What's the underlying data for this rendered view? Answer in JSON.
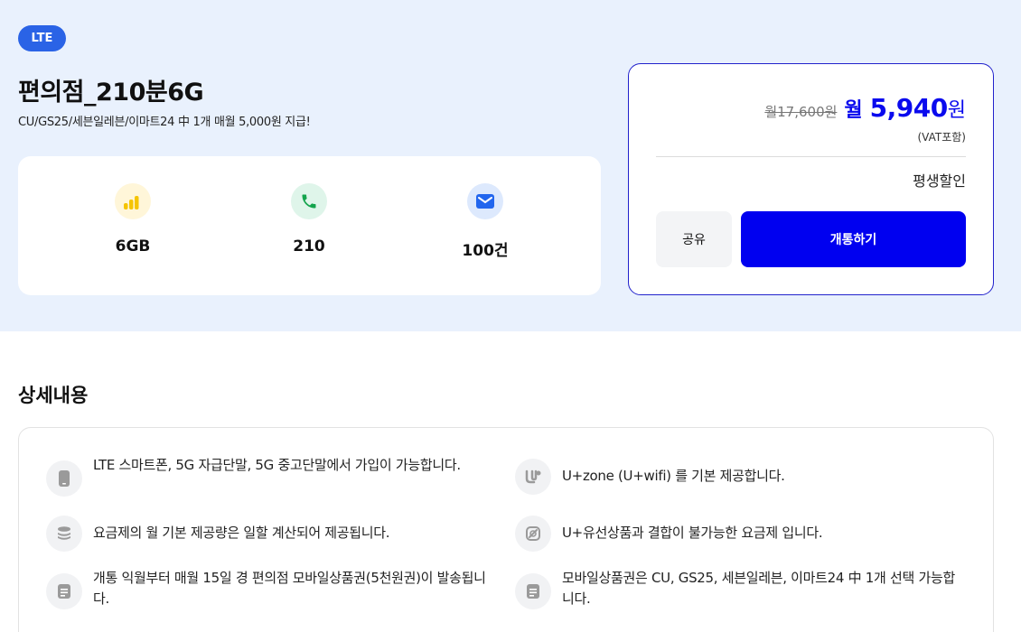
{
  "plan": {
    "badge": "LTE",
    "title": "편의점_210분6G",
    "subtitle": "CU/GS25/세븐일레븐/이마트24 中 1개 매월 5,000원 지급!",
    "specs": [
      {
        "icon": "signal-bars-icon",
        "value": "6GB"
      },
      {
        "icon": "phone-icon",
        "value": "210"
      },
      {
        "icon": "mail-icon",
        "value": "100건"
      }
    ]
  },
  "price": {
    "original": "월17,600원",
    "prefix": "월",
    "amount": "5,940",
    "unit": "원",
    "vat": "(VAT포함)",
    "discount": "평생할인",
    "share_label": "공유",
    "open_label": "개통하기"
  },
  "details": {
    "title": "상세내용",
    "items": [
      {
        "icon": "smartphone-icon",
        "text": "LTE 스마트폰, 5G 자급단말, 5G 중고단말에서 가입이 가능합니다."
      },
      {
        "icon": "uplus-zone-icon",
        "text": "U+zone (U+wifi) 를 기본 제공합니다."
      },
      {
        "icon": "database-icon",
        "text": "요금제의 월 기본 제공량은 일할 계산되어 제공됩니다."
      },
      {
        "icon": "no-link-icon",
        "text": "U+유선상품과 결합이 불가능한 요금제 입니다."
      },
      {
        "icon": "document-icon",
        "text": "개통 익월부터 매월 15일 경 편의점 모바일상품권(5천원권)이 발송됩니다."
      },
      {
        "icon": "document-icon",
        "text": "모바일상품권은 CU, GS25, 세븐일레븐, 이마트24 中 1개 선택 가능합니다."
      }
    ]
  },
  "colors": {
    "hero_bg": "#e9f1fd",
    "badge": "#2a63e6",
    "accent": "#0000f0",
    "price": "#0a0aee"
  }
}
